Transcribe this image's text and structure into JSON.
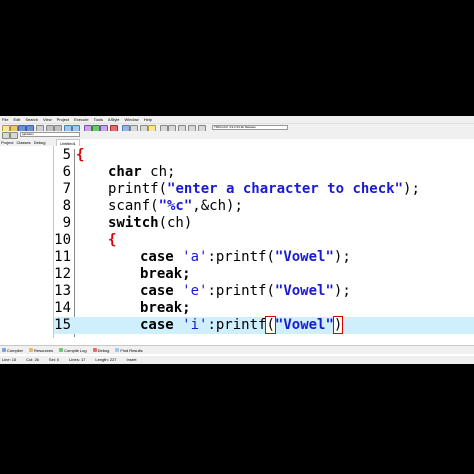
{
  "menu": [
    "File",
    "Edit",
    "Search",
    "View",
    "Project",
    "Execute",
    "Tools",
    "AStyle",
    "Window",
    "Help"
  ],
  "toolbar": {
    "compiler_select": "TDM-GCC 4.9.2 64-bit Release",
    "scope_select": "(globals)"
  },
  "panel_tabs": [
    "Project",
    "Classes",
    "Debug"
  ],
  "editor_tab": "Untitled1",
  "code_lines": [
    {
      "num": "5",
      "text": "{"
    },
    {
      "num": "6",
      "text": "char ch;"
    },
    {
      "num": "7",
      "text": "printf(\"enter a character to check\");"
    },
    {
      "num": "8",
      "text": "scanf(\"%c\",&ch);"
    },
    {
      "num": "9",
      "text": "switch(ch)"
    },
    {
      "num": "10",
      "text": "{"
    },
    {
      "num": "11",
      "text": "case 'a':printf(\"Vowel\");"
    },
    {
      "num": "12",
      "text": "break;"
    },
    {
      "num": "13",
      "text": "case 'e':printf(\"Vowel\");"
    },
    {
      "num": "14",
      "text": "break;"
    },
    {
      "num": "15",
      "text": "case 'i':printf(\"Vowel\")"
    }
  ],
  "bottom_tabs": [
    "Compiler",
    "Resources",
    "Compile Log",
    "Debug",
    "Find Results"
  ],
  "status": {
    "line": "Line: 15",
    "col": "Col: 26",
    "sel": "Sel: 0",
    "lines": "Lines: 17",
    "length": "Length: 227",
    "mode": "Insert"
  },
  "colors": {
    "keyword": "#000000",
    "string": "#1a1ad6",
    "brace": "#e00000",
    "current_line": "#cfeffd"
  }
}
